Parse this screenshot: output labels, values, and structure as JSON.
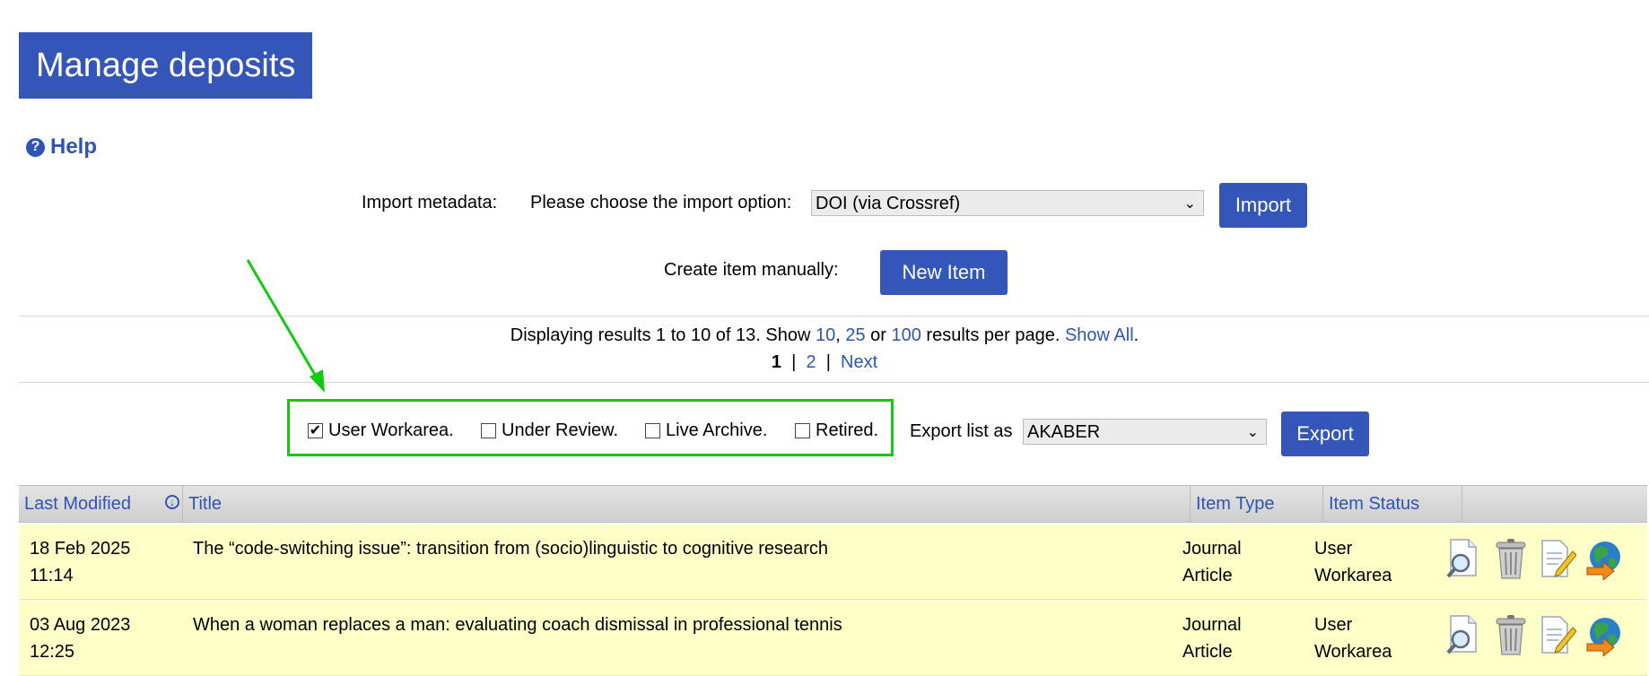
{
  "page": {
    "title": "Manage deposits"
  },
  "help": {
    "label": "Help"
  },
  "import": {
    "label": "Import metadata:",
    "choose_label": "Please choose the import option:",
    "selected_option": "DOI (via Crossref)",
    "button": "Import"
  },
  "create": {
    "label": "Create item manually:",
    "button": "New Item"
  },
  "results": {
    "prefix": "Displaying results 1 to 10 of 13. Show ",
    "opt_10": "10",
    "sep1": ", ",
    "opt_25": "25",
    "sep2": " or ",
    "opt_100": "100",
    "suffix": " results per page. ",
    "show_all": "Show All",
    "period": "."
  },
  "pagination": {
    "current": "1",
    "sep": "|",
    "page2": "2",
    "next": "Next"
  },
  "filters": [
    {
      "label": "User Workarea.",
      "checked": true
    },
    {
      "label": "Under Review.",
      "checked": false
    },
    {
      "label": "Live Archive.",
      "checked": false
    },
    {
      "label": "Retired.",
      "checked": false
    }
  ],
  "export": {
    "label": "Export list as",
    "selected_option": "AKABER",
    "button": "Export"
  },
  "table": {
    "headers": {
      "last_modified": "Last Modified",
      "title": "Title",
      "item_type": "Item Type",
      "item_status": "Item Status"
    },
    "rows": [
      {
        "date": "18 Feb 2025",
        "time": "11:14",
        "title": "The “code-switching issue”: transition from (socio)linguistic to cognitive research",
        "type_line1": "Journal",
        "type_line2": "Article",
        "status_line1": "User",
        "status_line2": "Workarea"
      },
      {
        "date": "03 Aug 2023",
        "time": "12:25",
        "title": "When a woman replaces a man: evaluating coach dismissal in professional tennis",
        "type_line1": "Journal",
        "type_line2": "Article",
        "status_line1": "User",
        "status_line2": "Workarea"
      }
    ]
  },
  "colors": {
    "accent": "#3356b8",
    "link": "#2f55b3",
    "highlight_box": "#14c914",
    "row_background": "#ffffc8"
  },
  "icons": [
    "view-icon",
    "delete-icon",
    "edit-icon",
    "deposit-icon"
  ]
}
